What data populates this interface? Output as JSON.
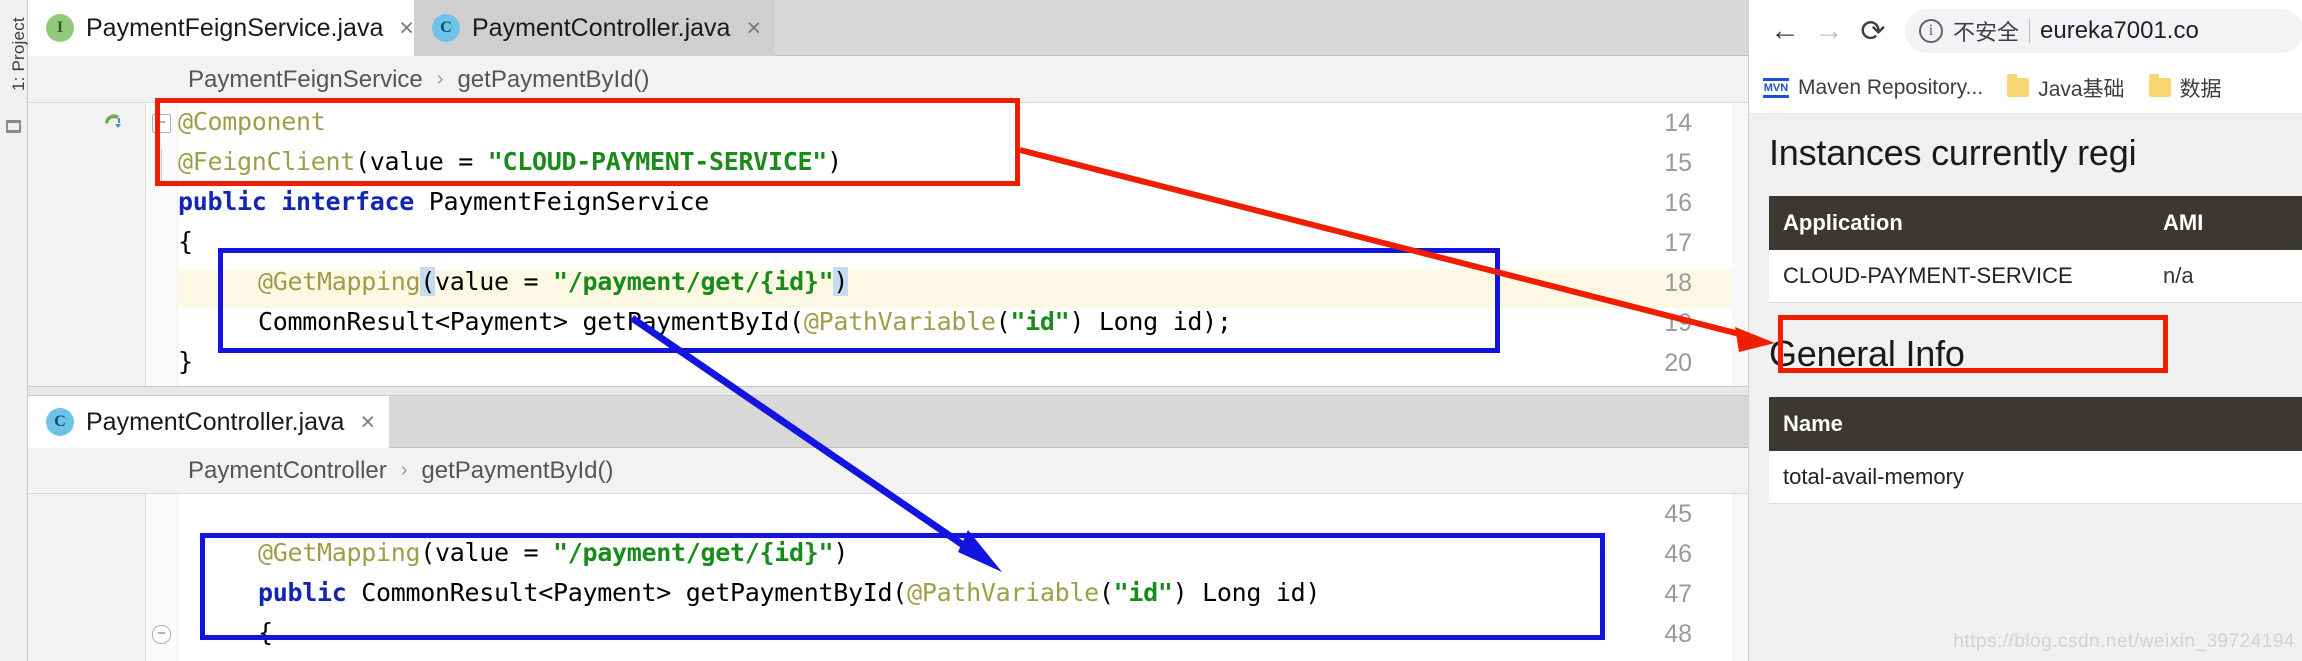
{
  "ide": {
    "project_rail_label": "1: Project",
    "tabs": [
      {
        "label": "PaymentFeignService.java",
        "icon": "interface-icon",
        "icon_letter": "I",
        "active": true,
        "close": "×"
      },
      {
        "label": "PaymentController.java",
        "icon": "class-icon",
        "icon_letter": "C",
        "active": false,
        "close": "×"
      }
    ],
    "panes": [
      {
        "breadcrumb": {
          "class": "PaymentFeignService",
          "separator": "›",
          "method": "getPaymentById()"
        },
        "lines": [
          {
            "no": "14",
            "tokens": [
              {
                "t": "@Component",
                "c": "t-anno"
              }
            ]
          },
          {
            "no": "15",
            "tokens": [
              {
                "t": "@FeignClient",
                "c": "t-anno"
              },
              {
                "t": "(value = ",
                "c": "t-plain"
              },
              {
                "t": "\"CLOUD-PAYMENT-SERVICE\"",
                "c": "t-str"
              },
              {
                "t": ")",
                "c": "t-plain"
              }
            ]
          },
          {
            "no": "16",
            "tokens": [
              {
                "t": "public interface ",
                "c": "t-kw"
              },
              {
                "t": "PaymentFeignService",
                "c": "t-plain"
              }
            ]
          },
          {
            "no": "17",
            "tokens": [
              {
                "t": "{",
                "c": "t-plain"
              }
            ]
          },
          {
            "no": "18",
            "highlight": true,
            "indent": 1,
            "tokens": [
              {
                "t": "@GetMapping",
                "c": "t-anno"
              },
              {
                "t": "(",
                "c": "t-plain t-sel"
              },
              {
                "t": "value = ",
                "c": "t-plain"
              },
              {
                "t": "\"/payment/get/{id}\"",
                "c": "t-str"
              },
              {
                "t": ")",
                "c": "t-plain t-sel"
              }
            ]
          },
          {
            "no": "19",
            "indent": 1,
            "tokens": [
              {
                "t": "CommonResult<Payment> getPaymentById(",
                "c": "t-plain"
              },
              {
                "t": "@PathVariable",
                "c": "t-anno"
              },
              {
                "t": "(",
                "c": "t-plain"
              },
              {
                "t": "\"id\"",
                "c": "t-str"
              },
              {
                "t": ") Long id);",
                "c": "t-plain"
              }
            ]
          },
          {
            "no": "20",
            "tokens": [
              {
                "t": "}",
                "c": "t-plain"
              }
            ]
          }
        ]
      },
      {
        "tab": {
          "label": "PaymentController.java",
          "icon": "class-icon",
          "icon_letter": "C",
          "close": "×"
        },
        "breadcrumb": {
          "class": "PaymentController",
          "separator": "›",
          "method": "getPaymentById()"
        },
        "lines": [
          {
            "no": "45",
            "tokens": [
              {
                "t": "",
                "c": "t-plain"
              }
            ]
          },
          {
            "no": "46",
            "indent": 1,
            "tokens": [
              {
                "t": "@GetMapping",
                "c": "t-anno"
              },
              {
                "t": "(value = ",
                "c": "t-plain"
              },
              {
                "t": "\"/payment/get/{id}\"",
                "c": "t-str"
              },
              {
                "t": ")",
                "c": "t-plain"
              }
            ]
          },
          {
            "no": "47",
            "indent": 1,
            "tokens": [
              {
                "t": "public ",
                "c": "t-kw"
              },
              {
                "t": "CommonResult<Payment> getPaymentById(",
                "c": "t-plain"
              },
              {
                "t": "@PathVariable",
                "c": "t-anno"
              },
              {
                "t": "(",
                "c": "t-plain"
              },
              {
                "t": "\"id\"",
                "c": "t-str"
              },
              {
                "t": ") Long id)",
                "c": "t-plain"
              }
            ]
          },
          {
            "no": "48",
            "indent": 1,
            "tokens": [
              {
                "t": "{",
                "c": "t-plain"
              }
            ]
          }
        ]
      }
    ]
  },
  "browser": {
    "nav": {
      "back": "←",
      "forward": "→",
      "reload": "⟳"
    },
    "omnibox": {
      "info_glyph": "i",
      "security_label": "不安全",
      "divider": "|",
      "url": "eureka7001.co"
    },
    "bookmarks": [
      {
        "label": "Maven Repository...",
        "icon": "mvn-icon",
        "icon_text": "MVN"
      },
      {
        "label": "Java基础",
        "icon": "folder-icon"
      },
      {
        "label": "数据",
        "icon": "folder-icon"
      }
    ],
    "page": {
      "instances_heading": "Instances currently regi",
      "instances_table": {
        "headers": [
          "Application",
          "AMI"
        ],
        "rows": [
          [
            "CLOUD-PAYMENT-SERVICE",
            "n/a"
          ]
        ]
      },
      "general_heading": "General Info",
      "general_table": {
        "headers": [
          "Name"
        ],
        "rows": [
          [
            "total-avail-memory"
          ]
        ]
      }
    },
    "watermark": "https://blog.csdn.net/weixin_39724194"
  },
  "annotations": {
    "red_box_feign_label": "feign-client-annotation-highlight",
    "red_box_service_label": "registered-service-name-highlight",
    "blue_box_interface_label": "feign-interface-method-highlight",
    "blue_box_controller_label": "controller-method-highlight",
    "red_arrow_label": "feign-name-to-eureka-arrow",
    "blue_arrow_label": "interface-to-controller-arrow",
    "colors": {
      "red": "#f01e00",
      "blue": "#1414e0",
      "accent_str": "#1a8b1a",
      "accent_anno": "#9e9e4a",
      "accent_kw": "#1226b3"
    }
  }
}
